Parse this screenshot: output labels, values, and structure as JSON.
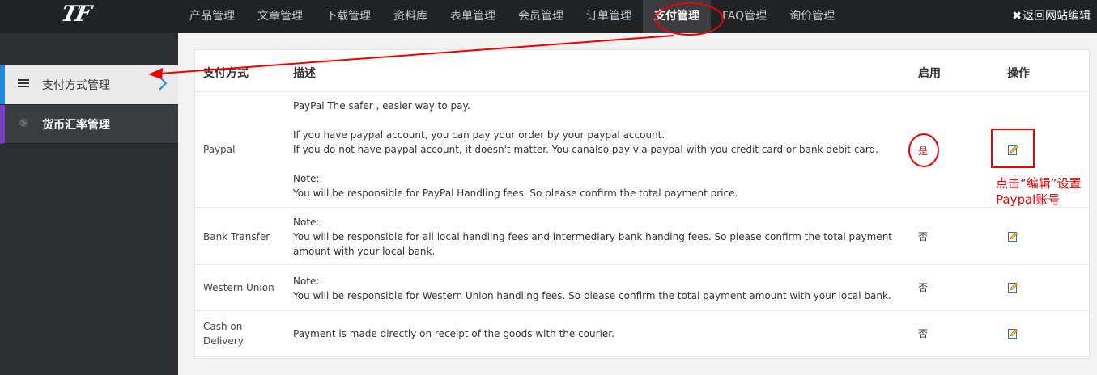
{
  "brand": {
    "logo": "TF"
  },
  "nav": {
    "items": [
      "产品管理",
      "文章管理",
      "下载管理",
      "资料库",
      "表单管理",
      "会员管理",
      "订单管理",
      "支付管理",
      "FAQ管理",
      "询价管理"
    ],
    "active": "支付管理",
    "back_x": "✖",
    "back_label": "返回网站编辑"
  },
  "sidebar": {
    "items": [
      {
        "label": "支付方式管理",
        "icon": "list-icon",
        "selected": true
      },
      {
        "label": "货币汇率管理",
        "icon": "globe-icon",
        "selected": false
      }
    ]
  },
  "table": {
    "headers": {
      "method": "支付方式",
      "description": "描述",
      "enabled": "启用",
      "actions": "操作"
    },
    "rows": [
      {
        "method": "Paypal",
        "description": {
          "title": "PayPal The safer , easier way to pay.",
          "line1": "If you have paypal account, you can pay your order by your paypal account.",
          "line2": "If you do not have paypal account, it doesn't matter. You canalso pay via paypal with you credit card or bank debit card.",
          "note_label": "Note:",
          "note": "You will be responsible for PayPal Handling fees. So please confirm the total payment price."
        },
        "enabled": "是",
        "action_icon": "edit-icon"
      },
      {
        "method": "Bank Transfer",
        "description": {
          "note_label": "Note:",
          "line1": "You will be responsible for all local handling fees and intermediary bank handing fees. So please confirm the total payment",
          "line2": "amount with your local bank."
        },
        "enabled": "否",
        "action_icon": "edit-icon"
      },
      {
        "method": "Western Union",
        "description": {
          "note_label": "Note:",
          "line1": "You will be responsible for Western Union handling fees. So please confirm the total payment amount with your local bank."
        },
        "enabled": "否",
        "action_icon": "edit-icon"
      },
      {
        "method_line1": "Cash on",
        "method_line2": "Delivery",
        "description": {
          "line1": "Payment is made directly on receipt of the goods with the courier."
        },
        "enabled": "否",
        "action_icon": "edit-icon"
      }
    ]
  },
  "annotation": {
    "line1": "点击“编辑”设置",
    "line2": "Paypal账号",
    "color": "#e00000"
  },
  "colors": {
    "topbar": "#202224",
    "sidebar": "#2b2d30",
    "accent": "#1e88e5",
    "purple": "#7b3fc4",
    "annotation": "#e00000"
  }
}
